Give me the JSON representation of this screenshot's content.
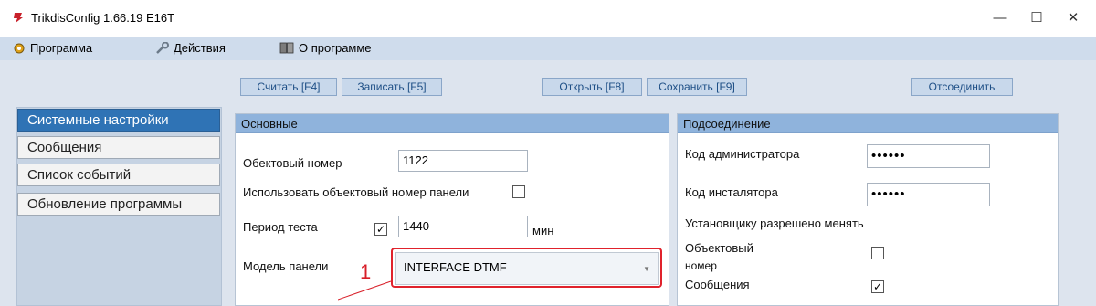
{
  "window": {
    "title": "TrikdisConfig 1.66.19   E16T",
    "minimize": "—",
    "maximize": "☐",
    "close": "✕"
  },
  "menu": {
    "program": "Программа",
    "actions": "Действия",
    "about": "О программе"
  },
  "toolbar": {
    "read": "Считать [F4]",
    "write": "Записать [F5]",
    "open": "Открыть [F8]",
    "save": "Сохранить [F9]",
    "disconnect": "Отсоединить"
  },
  "sidebar": {
    "items": [
      {
        "label": "Системные настройки",
        "active": true
      },
      {
        "label": "Сообщения",
        "active": false
      },
      {
        "label": "Список событий",
        "active": false
      },
      {
        "label": "Обновление программы",
        "active": false
      }
    ]
  },
  "basic": {
    "title": "Основные",
    "object_number_label": "Обектовый номер",
    "object_number_value": "1122",
    "use_panel_number_label": "Использовать объектовый номер панели",
    "use_panel_number_checked": "",
    "test_period_label": "Период теста",
    "test_period_checked": "✓",
    "test_period_value": "1440",
    "test_period_unit": "мин",
    "panel_model_label": "Модель панели",
    "panel_model_value": "INTERFACE DTMF",
    "callout_number": "1"
  },
  "connection": {
    "title": "Подсоединение",
    "admin_code_label": "Код администратора",
    "admin_code_value": "••••••",
    "installer_code_label": "Код инсталятора",
    "installer_code_value": "••••••",
    "installer_allowed_label": "Установщику разрешено менять",
    "object_number_label_line1": "Объектовый",
    "object_number_label_line2": "номер",
    "object_number_checked": "",
    "messages_label": "Сообщения",
    "messages_checked": "✓"
  },
  "colors": {
    "accent": "#2f73b5",
    "panel_header": "#8fb3dc",
    "highlight": "#e0222c"
  }
}
